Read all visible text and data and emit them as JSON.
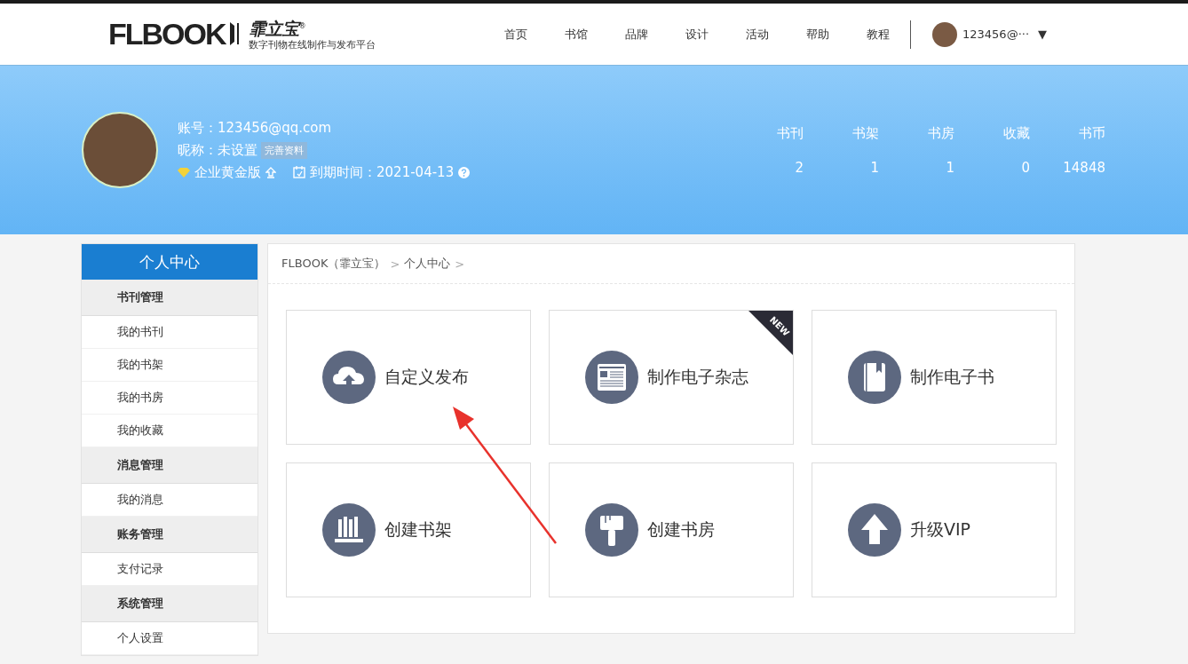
{
  "header": {
    "logo": "FLBOOK",
    "brand": "霏立宝",
    "brand_mark": "®",
    "tagline": "数字刊物在线制作与发布平台",
    "nav": [
      "首页",
      "书馆",
      "品牌",
      "设计",
      "活动",
      "帮助",
      "教程"
    ],
    "user": "123456@···",
    "caret": "▼"
  },
  "profile": {
    "account": "账号：123456@qq.com",
    "nickname": "昵称：未设置",
    "complete_button": "完善资料",
    "plan": "企业黄金版",
    "expiry": "到期时间：2021-04-13",
    "stats": [
      {
        "label": "书刊",
        "value": "2"
      },
      {
        "label": "书架",
        "value": "1"
      },
      {
        "label": "书房",
        "value": "1"
      },
      {
        "label": "收藏",
        "value": "0"
      },
      {
        "label": "书币",
        "value": "14848"
      }
    ]
  },
  "sidebar": {
    "title": "个人中心",
    "groups": [
      {
        "heading": "书刊管理",
        "items": [
          "我的书刊",
          "我的书架",
          "我的书房",
          "我的收藏"
        ]
      },
      {
        "heading": "消息管理",
        "items": [
          "我的消息"
        ]
      },
      {
        "heading": "账务管理",
        "items": [
          "支付记录"
        ]
      },
      {
        "heading": "系统管理",
        "items": [
          "个人设置"
        ]
      }
    ]
  },
  "breadcrumb": [
    {
      "label": "FLBOOK（霏立宝）",
      "sep": ">"
    },
    {
      "label": "个人中心",
      "sep": ">"
    }
  ],
  "tiles": [
    {
      "label": "自定义发布"
    },
    {
      "label": "制作电子杂志",
      "badge": "NEW"
    },
    {
      "label": "制作电子书"
    },
    {
      "label": "创建书架"
    },
    {
      "label": "创建书房"
    },
    {
      "label": "升级VIP"
    }
  ]
}
